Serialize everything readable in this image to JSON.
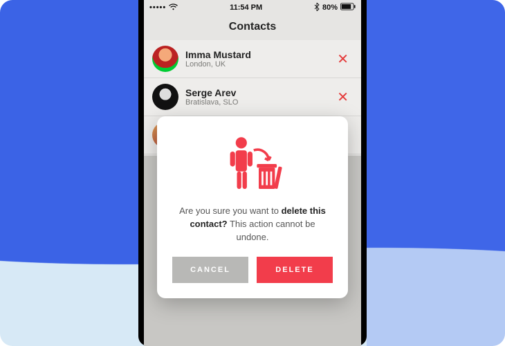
{
  "status": {
    "time": "11:54 PM",
    "battery": "80%"
  },
  "header": {
    "title": "Contacts"
  },
  "contacts": [
    {
      "name": "Imma Mustard",
      "location": "London, UK"
    },
    {
      "name": "Serge Arev",
      "location": "Bratislava, SLO"
    }
  ],
  "dialog": {
    "msg_pre": "Are you sure you want to ",
    "msg_bold": "delete this contact?",
    "msg_post": " This action cannot be undone.",
    "cancel": "CANCEL",
    "delete": "DELETE"
  }
}
